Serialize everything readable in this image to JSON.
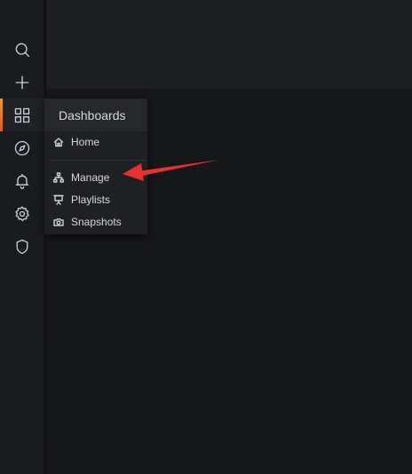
{
  "sidebar": {
    "items": [
      {
        "name": "search",
        "icon": "search-icon"
      },
      {
        "name": "create",
        "icon": "plus-icon"
      },
      {
        "name": "dashboards",
        "icon": "apps-grid-icon",
        "active": true
      },
      {
        "name": "explore",
        "icon": "compass-icon"
      },
      {
        "name": "alerting",
        "icon": "bell-icon"
      },
      {
        "name": "configuration",
        "icon": "gear-icon"
      },
      {
        "name": "server-admin",
        "icon": "shield-icon"
      }
    ]
  },
  "dashboards_menu": {
    "title": "Dashboards",
    "items": [
      {
        "label": "Home",
        "icon": "home-icon"
      },
      {
        "label": "Manage",
        "icon": "sitemap-icon"
      },
      {
        "label": "Playlists",
        "icon": "presentation-icon"
      },
      {
        "label": "Snapshots",
        "icon": "camera-icon"
      }
    ]
  },
  "annotation": {
    "color": "#e8302e"
  },
  "colors": {
    "accent": "#f79520",
    "background": "#161719",
    "sidebar": "#1a1b1f"
  }
}
